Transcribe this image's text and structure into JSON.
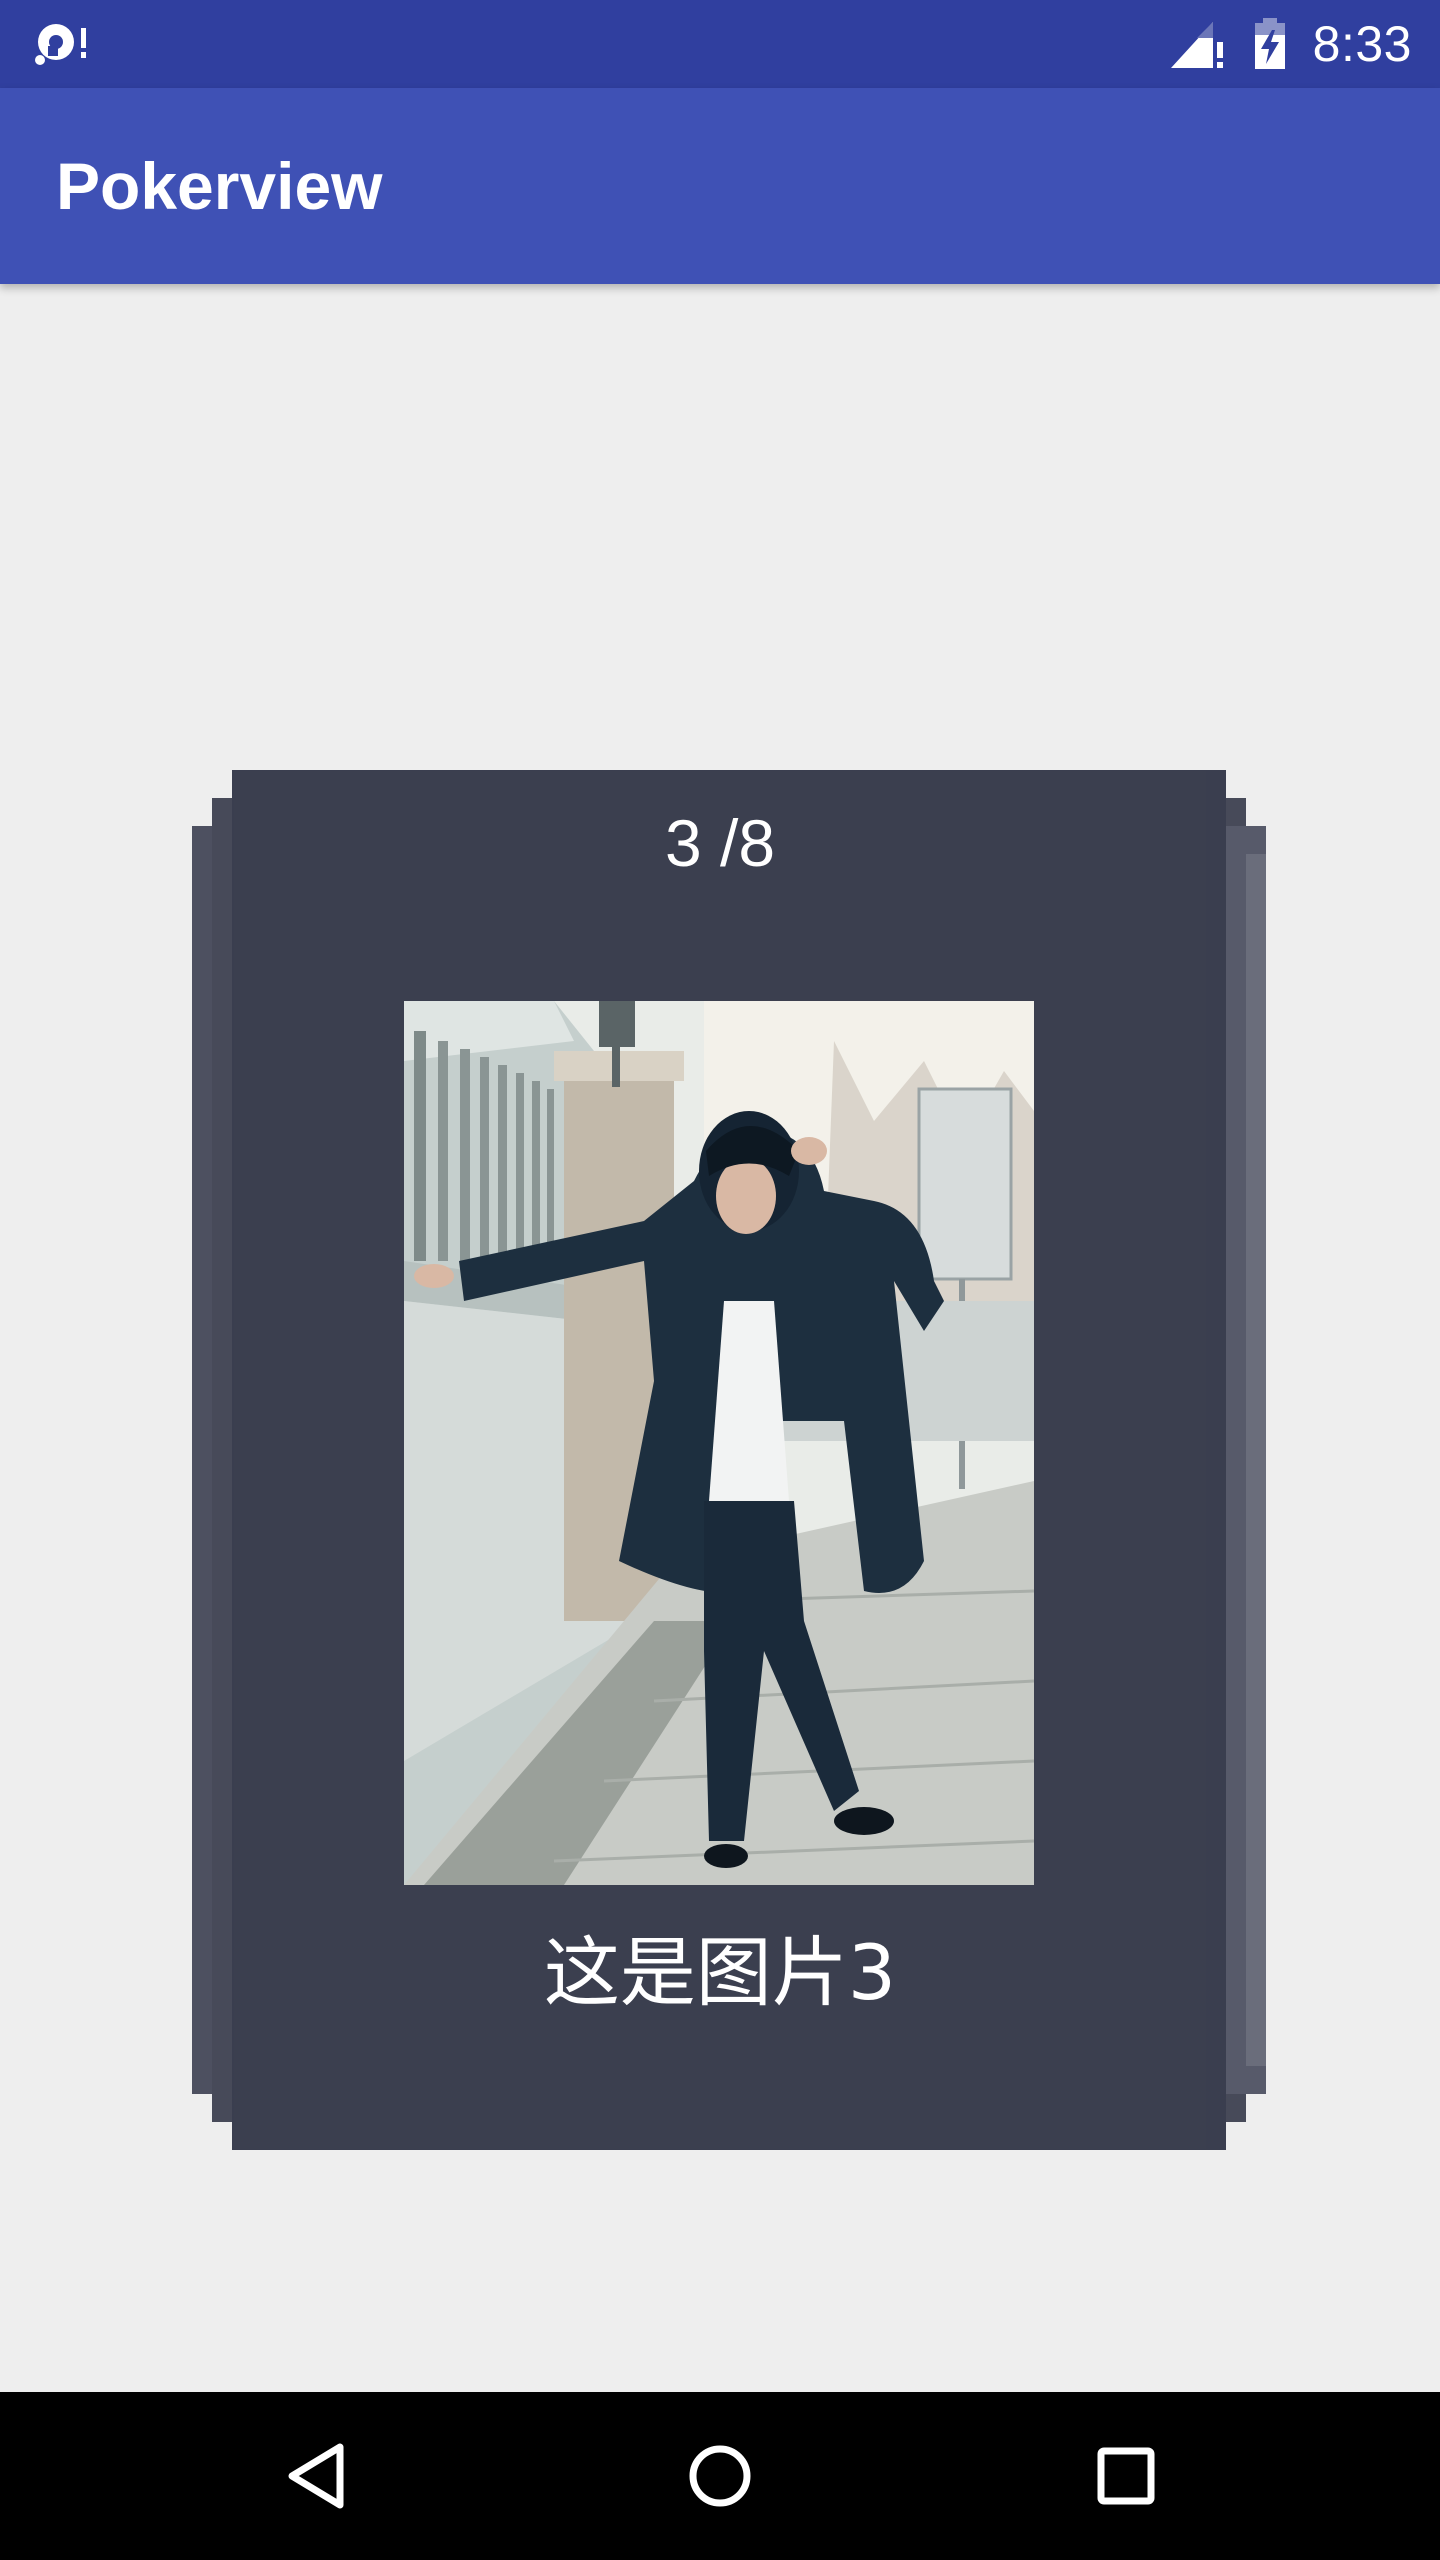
{
  "status_bar": {
    "time": "8:33",
    "left_icon": "sync-disabled-icon",
    "signal_icon": "signal-no-data-icon",
    "battery_icon": "battery-charging-icon"
  },
  "app_bar": {
    "title": "Pokerview"
  },
  "card": {
    "counter": "3 /8",
    "caption": "这是图片3",
    "photo_alt": "photo",
    "current_index": 3,
    "total": 8
  },
  "nav_bar": {
    "back_icon": "back-triangle-icon",
    "home_icon": "home-circle-icon",
    "recents_icon": "recents-square-icon"
  },
  "colors": {
    "status_bar": "#303f9f",
    "app_bar": "#3f51b5",
    "background": "#eeeeee",
    "card": "#3b3f4f"
  }
}
